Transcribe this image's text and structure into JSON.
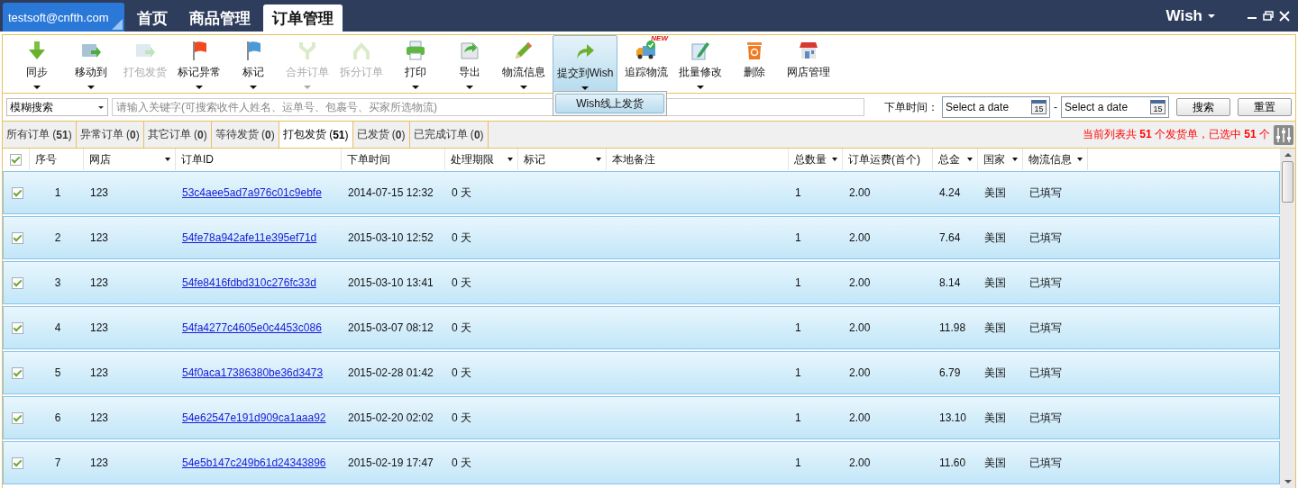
{
  "account": "testsoft@cnfth.com",
  "nav_tabs": [
    {
      "label": "首页",
      "selected": false
    },
    {
      "label": "商品管理",
      "selected": false
    },
    {
      "label": "订单管理",
      "selected": true
    }
  ],
  "platform": "Wish",
  "toolbar": [
    {
      "label": "同步",
      "disabled": false,
      "dropdown": true,
      "pressed": false
    },
    {
      "label": "移动到",
      "disabled": false,
      "dropdown": true,
      "pressed": false
    },
    {
      "label": "打包发货",
      "disabled": true,
      "dropdown": false,
      "pressed": false
    },
    {
      "label": "标记异常",
      "disabled": false,
      "dropdown": true,
      "pressed": false
    },
    {
      "label": "标记",
      "disabled": false,
      "dropdown": true,
      "pressed": false
    },
    {
      "label": "合并订单",
      "disabled": true,
      "dropdown": true,
      "pressed": false
    },
    {
      "label": "拆分订单",
      "disabled": true,
      "dropdown": false,
      "pressed": false
    },
    {
      "label": "打印",
      "disabled": false,
      "dropdown": true,
      "pressed": false
    },
    {
      "label": "导出",
      "disabled": false,
      "dropdown": true,
      "pressed": false
    },
    {
      "label": "物流信息",
      "disabled": false,
      "dropdown": true,
      "pressed": false
    },
    {
      "label": "提交到Wish",
      "disabled": false,
      "dropdown": true,
      "pressed": true
    },
    {
      "label": "追踪物流",
      "disabled": false,
      "dropdown": false,
      "pressed": false,
      "badge": "NEW"
    },
    {
      "label": "批量修改",
      "disabled": false,
      "dropdown": true,
      "pressed": false
    },
    {
      "label": "删除",
      "disabled": false,
      "dropdown": false,
      "pressed": false
    },
    {
      "label": "网店管理",
      "disabled": false,
      "dropdown": false,
      "pressed": false
    }
  ],
  "submenu": {
    "items": [
      "Wish线上发货"
    ]
  },
  "search": {
    "mode": "模糊搜索",
    "placeholder": "请输入关键字(可搜索收件人姓名、运单号、包裹号、买家所选物流)",
    "date_label": "下单时间：",
    "date_fields": [
      {
        "placeholder": "Select a date",
        "calendar_day": "15"
      },
      {
        "placeholder": "Select a date",
        "calendar_day": "15"
      }
    ],
    "separator": "-",
    "buttons": [
      "搜索",
      "重置"
    ]
  },
  "status_tabs": [
    {
      "label": "所有订单 (**51**)",
      "selected": false
    },
    {
      "label": "异常订单 (**0**)",
      "selected": false
    },
    {
      "label": "其它订单 (**0**)",
      "selected": false
    },
    {
      "label": "等待发货 (**0**)",
      "selected": false
    },
    {
      "label": "打包发货 (**51**)",
      "selected": true
    },
    {
      "label": "已发货 (**0**)",
      "selected": false
    },
    {
      "label": "已完成订单 (**0**)",
      "selected": false
    }
  ],
  "summary": "当前列表共 **51** 个发货单，已选中 **51** 个",
  "table": {
    "all_checked": true,
    "columns": [
      {
        "label": "序号",
        "filter": false
      },
      {
        "label": "网店",
        "filter": true
      },
      {
        "label": "订单ID",
        "filter": false
      },
      {
        "label": "下单时间",
        "filter": false
      },
      {
        "label": "处理期限",
        "filter": true
      },
      {
        "label": "标记",
        "filter": true
      },
      {
        "label": "本地备注",
        "filter": false
      },
      {
        "label": "总数量",
        "filter": true
      },
      {
        "label": "订单运费(首个)",
        "filter": false
      },
      {
        "label": "总金",
        "filter": true
      },
      {
        "label": "国家",
        "filter": true
      },
      {
        "label": "物流信息",
        "filter": true
      }
    ],
    "rows": [
      {
        "checked": true,
        "cells": [
          "1",
          "123",
          "53c4aee5ad7a976c01c9ebfe",
          "2014-07-15 12:32",
          "0 天",
          "",
          "",
          "1",
          "2.00",
          "4.24",
          "美国",
          "已填写"
        ]
      },
      {
        "checked": true,
        "cells": [
          "2",
          "123",
          "54fe78a942afe11e395ef71d",
          "2015-03-10 12:52",
          "0 天",
          "",
          "",
          "1",
          "2.00",
          "7.64",
          "美国",
          "已填写"
        ]
      },
      {
        "checked": true,
        "cells": [
          "3",
          "123",
          "54fe8416fdbd310c276fc33d",
          "2015-03-10 13:41",
          "0 天",
          "",
          "",
          "1",
          "2.00",
          "8.14",
          "美国",
          "已填写"
        ]
      },
      {
        "checked": true,
        "cells": [
          "4",
          "123",
          "54fa4277c4605e0c4453c086",
          "2015-03-07 08:12",
          "0 天",
          "",
          "",
          "1",
          "2.00",
          "11.98",
          "美国",
          "已填写"
        ]
      },
      {
        "checked": true,
        "cells": [
          "5",
          "123",
          "54f0aca17386380be36d3473",
          "2015-02-28 01:42",
          "0 天",
          "",
          "",
          "1",
          "2.00",
          "6.79",
          "美国",
          "已填写"
        ]
      },
      {
        "checked": true,
        "cells": [
          "6",
          "123",
          "54e62547e191d909ca1aaa92",
          "2015-02-20 02:02",
          "0 天",
          "",
          "",
          "1",
          "2.00",
          "13.10",
          "美国",
          "已填写"
        ]
      },
      {
        "checked": true,
        "cells": [
          "7",
          "123",
          "54e5b147c249b61d24343896",
          "2015-02-19 17:47",
          "0 天",
          "",
          "",
          "1",
          "2.00",
          "11.60",
          "美国",
          "已填写"
        ]
      }
    ]
  }
}
